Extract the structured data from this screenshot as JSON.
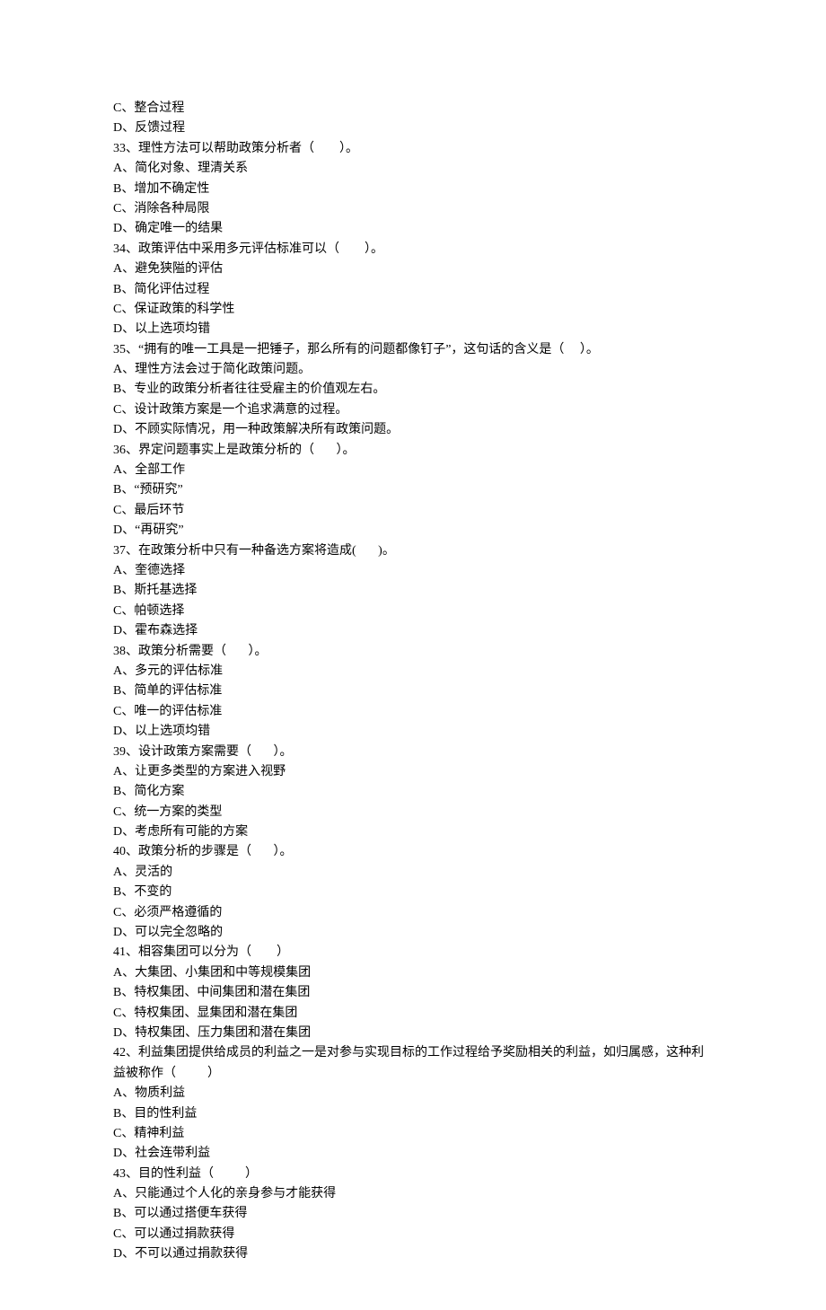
{
  "lines": [
    "C、整合过程",
    "D、反馈过程",
    "33、理性方法可以帮助政策分析者（        ）。",
    "A、简化对象、理清关系",
    "B、增加不确定性",
    "C、消除各种局限",
    "D、确定唯一的结果",
    "34、政策评估中采用多元评估标准可以（        ）。",
    "A、避免狭隘的评估",
    "B、简化评估过程",
    "C、保证政策的科学性",
    "D、以上选项均错",
    "35、“拥有的唯一工具是一把锤子，那么所有的问题都像钉子”，这句话的含义是（     ）。",
    "A、理性方法会过于简化政策问题。",
    "B、专业的政策分析者往往受雇主的价值观左右。",
    "C、设计政策方案是一个追求满意的过程。",
    "D、不顾实际情况，用一种政策解决所有政策问题。",
    "36、界定问题事实上是政策分析的（       ）。",
    "A、全部工作",
    "B、“预研究”",
    "C、最后环节",
    "D、“再研究”",
    "37、在政策分析中只有一种备选方案将造成(       )。",
    "A、奎德选择",
    "B、斯托基选择",
    "C、帕顿选择",
    "D、霍布森选择",
    "38、政策分析需要（       ）。",
    "A、多元的评估标准",
    "B、简单的评估标准",
    "C、唯一的评估标准",
    "D、以上选项均错",
    "39、设计政策方案需要（       ）。",
    "A、让更多类型的方案进入视野",
    "B、简化方案",
    "C、统一方案的类型",
    "D、考虑所有可能的方案",
    "40、政策分析的步骤是（       ）。",
    "A、灵活的",
    "B、不变的",
    "C、必须严格遵循的",
    "D、可以完全忽略的",
    "41、相容集团可以分为（        ）",
    "A、大集团、小集团和中等规模集团",
    "B、特权集团、中间集团和潜在集团",
    "C、特权集团、显集团和潜在集团",
    "D、特权集团、压力集团和潜在集团",
    "42、利益集团提供给成员的利益之一是对参与实现目标的工作过程给予奖励相关的利益，如归属感，这种利益被称作（          ）",
    "A、物质利益",
    "B、目的性利益",
    "C、精神利益",
    "D、社会连带利益",
    "43、目的性利益（          ）",
    "A、只能通过个人化的亲身参与才能获得",
    "B、可以通过搭便车获得",
    "C、可以通过捐款获得",
    "D、不可以通过捐款获得"
  ]
}
